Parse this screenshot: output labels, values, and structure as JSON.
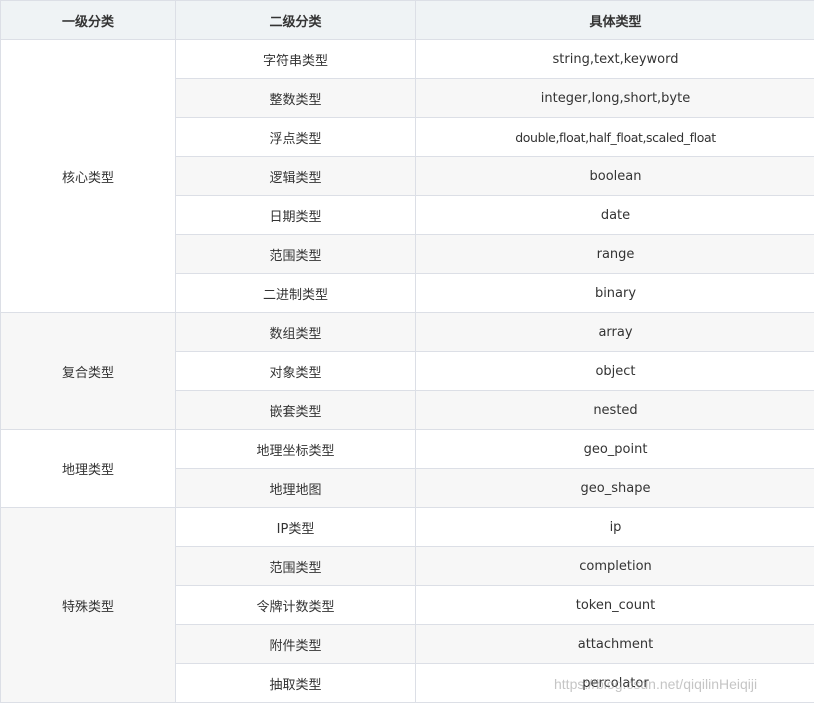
{
  "headers": [
    "一级分类",
    "二级分类",
    "具体类型"
  ],
  "groups": [
    {
      "name": "核心类型",
      "rows": [
        [
          "字符串类型",
          "string,text,keyword"
        ],
        [
          "整数类型",
          "integer,long,short,byte"
        ],
        [
          "浮点类型",
          "double,float,half_float,scaled_float"
        ],
        [
          "逻辑类型",
          "boolean"
        ],
        [
          "日期类型",
          "date"
        ],
        [
          "范围类型",
          "range"
        ],
        [
          "二进制类型",
          "binary"
        ]
      ]
    },
    {
      "name": "复合类型",
      "rows": [
        [
          "数组类型",
          "array"
        ],
        [
          "对象类型",
          "object"
        ],
        [
          "嵌套类型",
          "nested"
        ]
      ]
    },
    {
      "name": "地理类型",
      "rows": [
        [
          "地理坐标类型",
          "geo_point"
        ],
        [
          "地理地图",
          "geo_shape"
        ]
      ]
    },
    {
      "name": "特殊类型",
      "rows": [
        [
          "IP类型",
          "ip"
        ],
        [
          "范围类型",
          "completion"
        ],
        [
          "令牌计数类型",
          "token_count"
        ],
        [
          "附件类型",
          "attachment"
        ],
        [
          "抽取类型",
          "percolator"
        ]
      ]
    }
  ],
  "watermark": "https://blog.csdn.net/qiqilinHeiqiji"
}
